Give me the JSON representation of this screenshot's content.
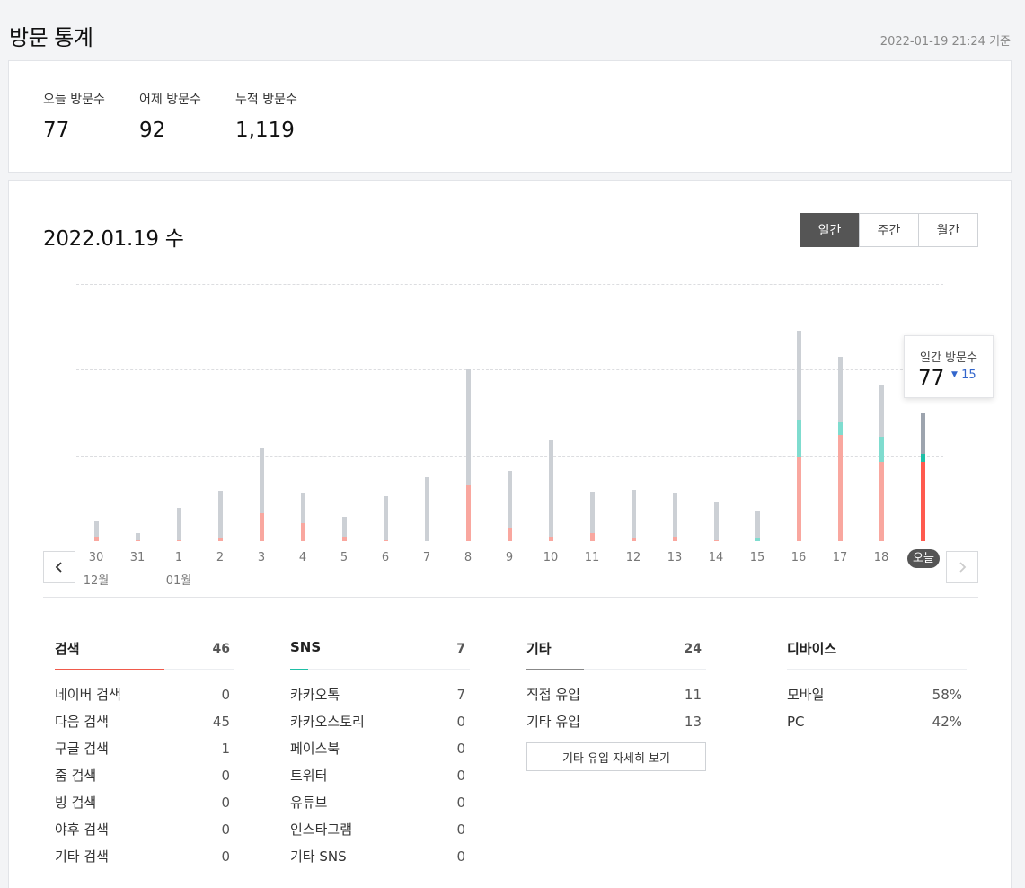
{
  "page": {
    "title": "방문 통계",
    "updated": "2022-01-19 21:24 기준"
  },
  "summary": [
    {
      "label": "오늘 방문수",
      "value": "77"
    },
    {
      "label": "어제 방문수",
      "value": "92"
    },
    {
      "label": "누적 방문수",
      "value": "1,119"
    }
  ],
  "date_title": "2022.01.19 수",
  "period_tabs": [
    "일간",
    "주간",
    "월간"
  ],
  "tooltip": {
    "label": "일간 방문수",
    "value": "77",
    "diff": "15"
  },
  "colors": {
    "search": "#f9a79f",
    "search_today": "#ff5a4e",
    "sns": "#7fdccf",
    "sns_today": "#1fbfa6",
    "other": "#ccd0d5",
    "other_today": "#9da4ae",
    "accent_search": "#f05a4b",
    "accent_sns": "#1fbfa6",
    "accent_other": "#888888"
  },
  "chart_data": {
    "type": "bar",
    "stacked": true,
    "categories": [
      "30",
      "31",
      "1",
      "2",
      "3",
      "4",
      "5",
      "6",
      "7",
      "8",
      "9",
      "10",
      "11",
      "12",
      "13",
      "14",
      "15",
      "16",
      "17",
      "18",
      "오늘"
    ],
    "month_labels": [
      {
        "index": 0,
        "label": "12월"
      },
      {
        "index": 2,
        "label": "01월"
      }
    ],
    "series": [
      {
        "name": "검색",
        "values": [
          4,
          1,
          1,
          2,
          24,
          16,
          4,
          1,
          0,
          49,
          11,
          4,
          7,
          2,
          4,
          1,
          0,
          73,
          93,
          69,
          69
        ]
      },
      {
        "name": "SNS",
        "values": [
          0,
          0,
          0,
          0,
          0,
          0,
          0,
          0,
          0,
          0,
          0,
          0,
          0,
          0,
          0,
          0,
          2,
          33,
          12,
          22,
          7
        ]
      },
      {
        "name": "기타",
        "values": [
          13,
          6,
          28,
          42,
          58,
          26,
          17,
          38,
          56,
          102,
          50,
          85,
          36,
          43,
          38,
          34,
          24,
          78,
          56,
          46,
          36
        ]
      }
    ],
    "ylim": [
      0,
      225
    ],
    "grid": true,
    "gridlines": [
      75,
      150,
      225
    ]
  },
  "breakdown": {
    "search": {
      "title": "검색",
      "total": "46",
      "rows": [
        {
          "name": "네이버 검색",
          "value": "0"
        },
        {
          "name": "다음 검색",
          "value": "45"
        },
        {
          "name": "구글 검색",
          "value": "1"
        },
        {
          "name": "줌 검색",
          "value": "0"
        },
        {
          "name": "빙 검색",
          "value": "0"
        },
        {
          "name": "야후 검색",
          "value": "0"
        },
        {
          "name": "기타 검색",
          "value": "0"
        }
      ]
    },
    "sns": {
      "title": "SNS",
      "total": "7",
      "rows": [
        {
          "name": "카카오톡",
          "value": "7"
        },
        {
          "name": "카카오스토리",
          "value": "0"
        },
        {
          "name": "페이스북",
          "value": "0"
        },
        {
          "name": "트위터",
          "value": "0"
        },
        {
          "name": "유튜브",
          "value": "0"
        },
        {
          "name": "인스타그램",
          "value": "0"
        },
        {
          "name": "기타 SNS",
          "value": "0"
        }
      ]
    },
    "other": {
      "title": "기타",
      "total": "24",
      "rows": [
        {
          "name": "직접 유입",
          "value": "11"
        },
        {
          "name": "기타 유입",
          "value": "13"
        }
      ],
      "detail_button": "기타 유입 자세히 보기"
    },
    "device": {
      "title": "디바이스",
      "rows": [
        {
          "name": "모바일",
          "value": "58%"
        },
        {
          "name": "PC",
          "value": "42%"
        }
      ]
    }
  }
}
